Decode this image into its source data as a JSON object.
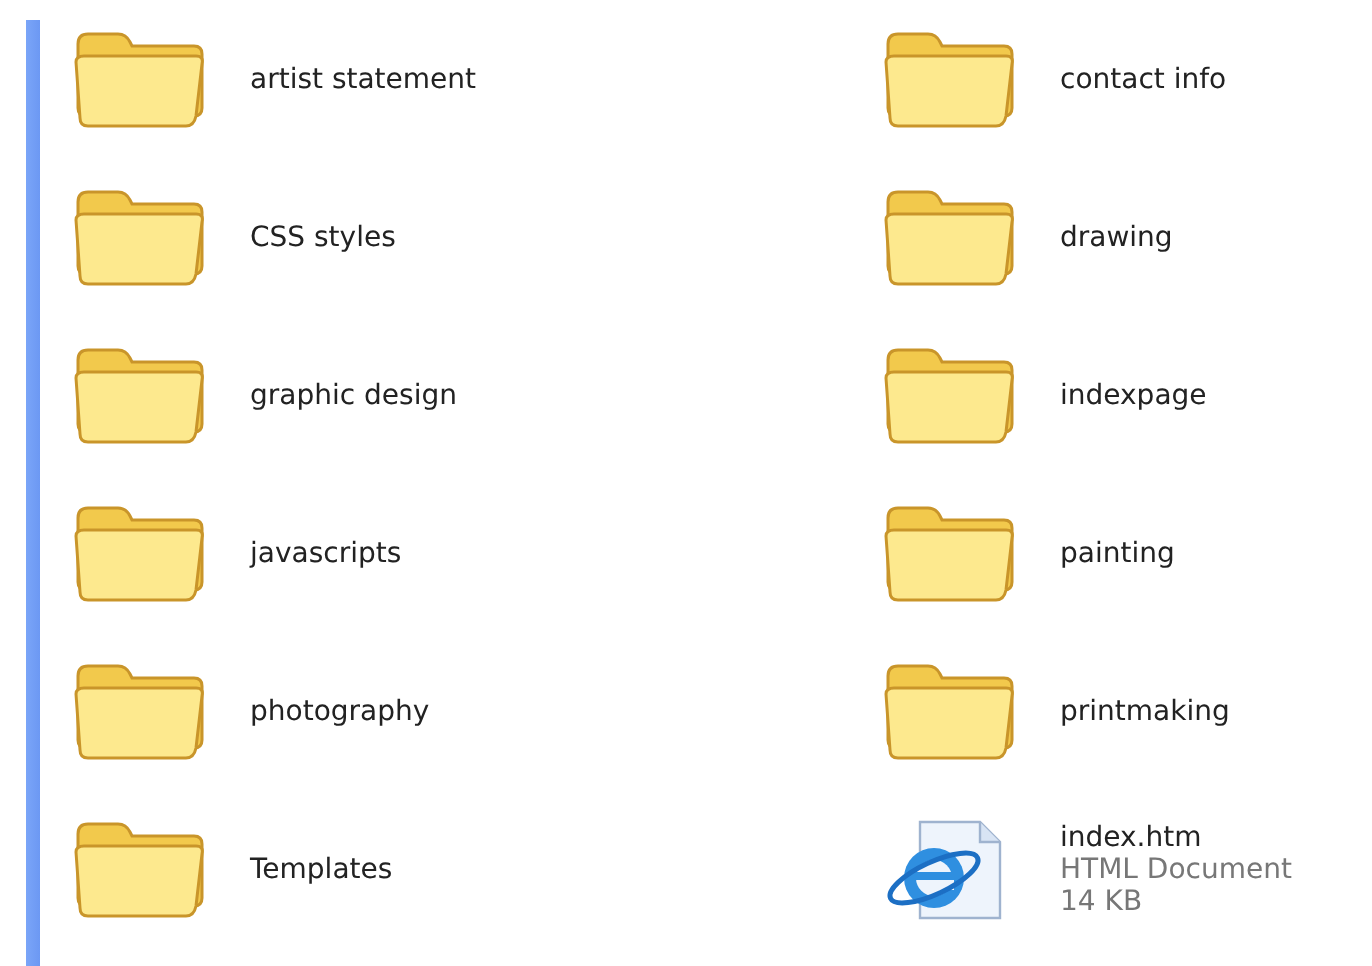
{
  "items": [
    {
      "kind": "folder",
      "name": "artist statement"
    },
    {
      "kind": "folder",
      "name": "CSS styles"
    },
    {
      "kind": "folder",
      "name": "graphic design"
    },
    {
      "kind": "folder",
      "name": "javascripts"
    },
    {
      "kind": "folder",
      "name": "photography"
    },
    {
      "kind": "folder",
      "name": "Templates"
    },
    {
      "kind": "folder",
      "name": "contact info"
    },
    {
      "kind": "folder",
      "name": "drawing"
    },
    {
      "kind": "folder",
      "name": "indexpage"
    },
    {
      "kind": "folder",
      "name": "painting"
    },
    {
      "kind": "folder",
      "name": "printmaking"
    },
    {
      "kind": "file",
      "name": "index.htm",
      "type": "HTML Document",
      "size": "14 KB"
    }
  ]
}
